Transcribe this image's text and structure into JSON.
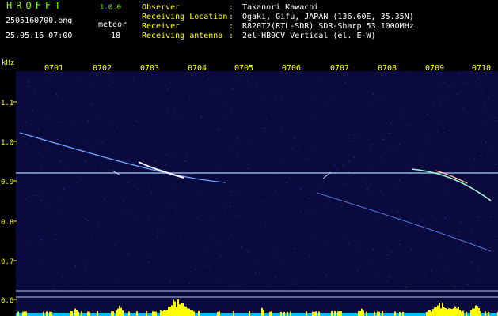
{
  "app": {
    "title": "HROFFT",
    "version": "1.0.0"
  },
  "capture": {
    "file_name": "2505160700.png",
    "date_time": "25.05.16 07:00"
  },
  "meteor": {
    "label": "meteor",
    "count": "18"
  },
  "info": [
    {
      "label": "Observer",
      "value": "Takanori Kawachi"
    },
    {
      "label": "Receiving Location",
      "value": "Ogaki, Gifu, JAPAN (136.60E, 35.35N)"
    },
    {
      "label": "Receiver",
      "value": "R820T2(RTL-SDR) SDR-Sharp 53.1000MHz"
    },
    {
      "label": "Receiving antenna",
      "value": "2el-HB9CV Vertical (el. E-W)"
    }
  ],
  "separator": ":",
  "axis": {
    "unit": "kHz",
    "y_ticks": [
      "1.1",
      "1.0",
      "0.9",
      "0.8",
      "0.7",
      "0.6"
    ],
    "x_ticks": [
      "0701",
      "0702",
      "0703",
      "0704",
      "0705",
      "0706",
      "0707",
      "0708",
      "0709",
      "0710"
    ]
  },
  "colors": {
    "background": "#000000",
    "header_text": "#7CFC00",
    "label_text": "#FFFF00",
    "info_text": "#FFFFFF",
    "spectrogram_bg": "#0a0a3e",
    "carrier": "#aee0ff",
    "activity": "#FFFF00",
    "activity_base": "#00BFFF"
  }
}
